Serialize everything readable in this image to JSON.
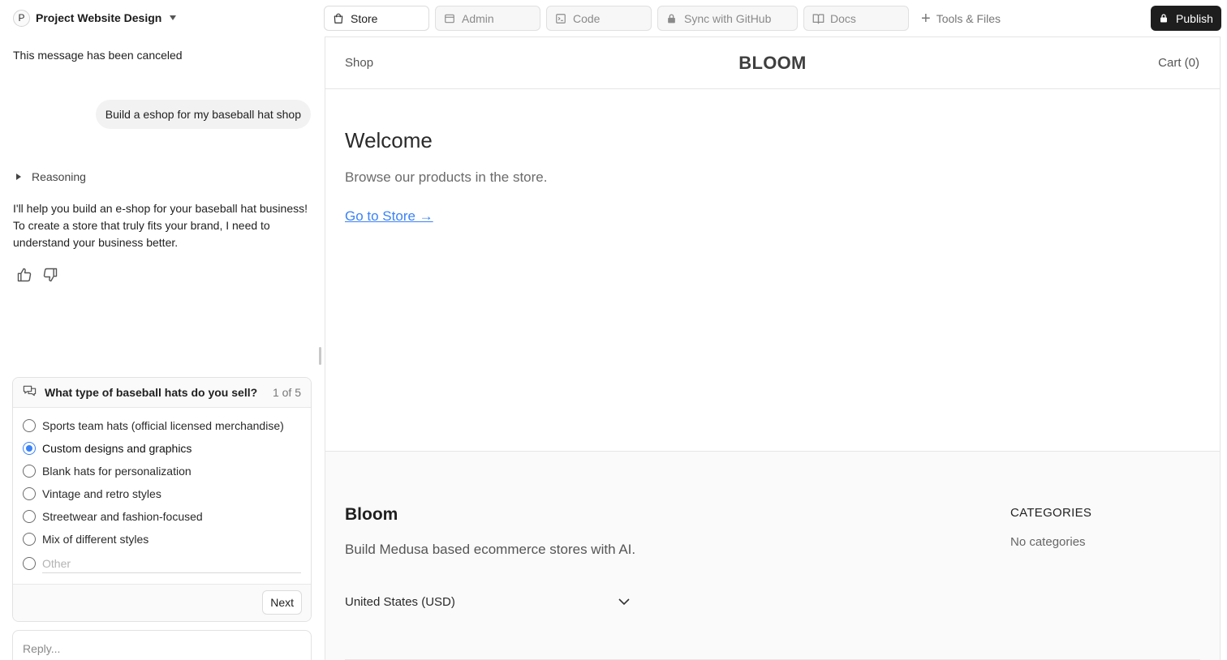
{
  "project": {
    "avatar_letter": "P",
    "name": "Project Website Design"
  },
  "chat": {
    "canceled_notice": "This message has been canceled",
    "user_message": "Build a eshop for my baseball hat shop",
    "reasoning_label": "Reasoning",
    "assistant_message": "I'll help you build an e-shop for your baseball hat business! To create a store that truly fits your brand, I need to understand your business better."
  },
  "question": {
    "title": "What type of baseball hats do you sell?",
    "progress": "1 of 5",
    "options": [
      "Sports team hats (official licensed merchandise)",
      "Custom designs and graphics",
      "Blank hats for personalization",
      "Vintage and retro styles",
      "Streetwear and fashion-focused",
      "Mix of different styles"
    ],
    "selected_option": "Custom designs and graphics",
    "other_placeholder": "Other",
    "next_label": "Next"
  },
  "composer": {
    "placeholder": "Reply..."
  },
  "tabs": [
    {
      "label": "Store",
      "icon": "shopping-bag-icon",
      "active": true
    },
    {
      "label": "Admin",
      "icon": "window-icon",
      "active": false
    },
    {
      "label": "Code",
      "icon": "terminal-icon",
      "active": false
    },
    {
      "label": "Sync with GitHub",
      "icon": "lock-icon",
      "active": false
    },
    {
      "label": "Docs",
      "icon": "book-icon",
      "active": false
    }
  ],
  "tools_label": "Tools & Files",
  "publish_label": "Publish",
  "store": {
    "nav": {
      "shop": "Shop",
      "brand": "BLOOM",
      "cart": "Cart (0)"
    },
    "hero": {
      "title": "Welcome",
      "subtitle": "Browse our products in the store.",
      "link": "Go to Store →"
    },
    "footer": {
      "brand": "Bloom",
      "tagline": "Build Medusa based ecommerce stores with AI.",
      "region": "United States (USD)",
      "categories_heading": "CATEGORIES",
      "categories_empty": "No categories"
    }
  },
  "colors": {
    "accent": "#3b82f6",
    "publish_bg": "#1e1e1e"
  }
}
